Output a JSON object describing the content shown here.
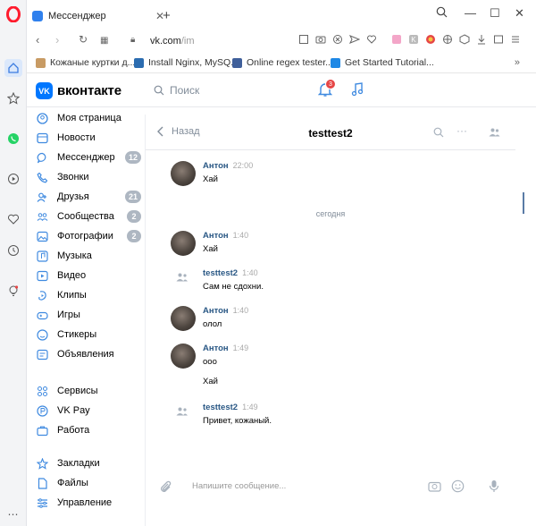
{
  "browser": {
    "tab_title": "Мессенджер",
    "url_host": "vk.com",
    "url_path": "/im",
    "bookmarks": [
      {
        "label": "Кожаные куртки д..."
      },
      {
        "label": "Install Nginx, MySQ..."
      },
      {
        "label": "Online regex tester..."
      },
      {
        "label": "Get Started Tutorial..."
      }
    ]
  },
  "vk": {
    "logo_text": "вконтакте",
    "logo_mark": "VK",
    "search_placeholder": "Поиск",
    "notifications_count": "3",
    "menu": [
      {
        "label": "Моя страница",
        "count": ""
      },
      {
        "label": "Новости",
        "count": ""
      },
      {
        "label": "Мессенджер",
        "count": "12"
      },
      {
        "label": "Звонки",
        "count": ""
      },
      {
        "label": "Друзья",
        "count": "21"
      },
      {
        "label": "Сообщества",
        "count": "2"
      },
      {
        "label": "Фотографии",
        "count": "2"
      },
      {
        "label": "Музыка",
        "count": ""
      },
      {
        "label": "Видео",
        "count": ""
      },
      {
        "label": "Клипы",
        "count": ""
      },
      {
        "label": "Игры",
        "count": ""
      },
      {
        "label": "Стикеры",
        "count": ""
      },
      {
        "label": "Объявления",
        "count": ""
      },
      {
        "label": "Сервисы",
        "count": ""
      },
      {
        "label": "VK Pay",
        "count": ""
      },
      {
        "label": "Работа",
        "count": ""
      },
      {
        "label": "Закладки",
        "count": ""
      },
      {
        "label": "Файлы",
        "count": ""
      },
      {
        "label": "Управление",
        "count": ""
      }
    ]
  },
  "chat": {
    "back_label": "Назад",
    "title": "testtest2",
    "day_divider": "сегодня",
    "composer_placeholder": "Напишите сообщение...",
    "messages": [
      {
        "author": "Антон",
        "time": "22:00",
        "lines": [
          "Хай"
        ]
      },
      {
        "author": "Антон",
        "time": "1:40",
        "lines": [
          "Хай"
        ]
      },
      {
        "author": "testtest2",
        "time": "1:40",
        "lines": [
          "Сам не сдохни."
        ]
      },
      {
        "author": "Антон",
        "time": "1:40",
        "lines": [
          "олол"
        ]
      },
      {
        "author": "Антон",
        "time": "1:49",
        "lines": [
          "ооо",
          "Хай"
        ]
      },
      {
        "author": "testtest2",
        "time": "1:49",
        "lines": [
          "Привет, кожаный."
        ]
      }
    ]
  },
  "colors": {
    "vk_blue": "#0077ff",
    "link_blue": "#2a5885",
    "badge_gray": "#aeb7c2",
    "notify_red": "#e64646",
    "opera_red": "#ff1b2d"
  }
}
